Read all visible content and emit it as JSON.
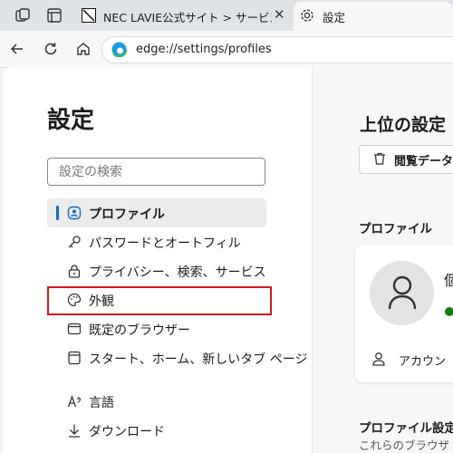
{
  "browser": {
    "tabs": [
      {
        "title": "NEC LAVIE公式サイト > サービス&サ",
        "active": false
      },
      {
        "title": "設定",
        "active": true
      }
    ],
    "address": "edge://settings/profiles"
  },
  "settings": {
    "title": "設定",
    "search_placeholder": "設定の検索",
    "nav": [
      {
        "label": "プロファイル",
        "icon": "profile-icon",
        "selected": true
      },
      {
        "label": "パスワードとオートフィル",
        "icon": "key-icon"
      },
      {
        "label": "プライバシー、検索、サービス",
        "icon": "lock-icon"
      },
      {
        "label": "外観",
        "icon": "palette-icon",
        "highlighted": true
      },
      {
        "label": "既定のブラウザー",
        "icon": "browser-icon"
      },
      {
        "label": "スタート、ホーム、新しいタブ ページ",
        "icon": "home-page-icon"
      },
      {
        "label": "言語",
        "icon": "language-icon"
      },
      {
        "label": "ダウンロード",
        "icon": "download-icon"
      }
    ]
  },
  "main": {
    "top_heading": "上位の設定",
    "clear_button": "閲覧データ",
    "profile_heading": "プロファイル",
    "profile_name_partial": "個",
    "account_label": "アカウン",
    "profile_settings_heading": "プロファイル設定",
    "profile_settings_desc": "これらのブラウザ"
  },
  "colors": {
    "accent": "#0f6cbd",
    "highlight_box": "#d51a1a"
  }
}
